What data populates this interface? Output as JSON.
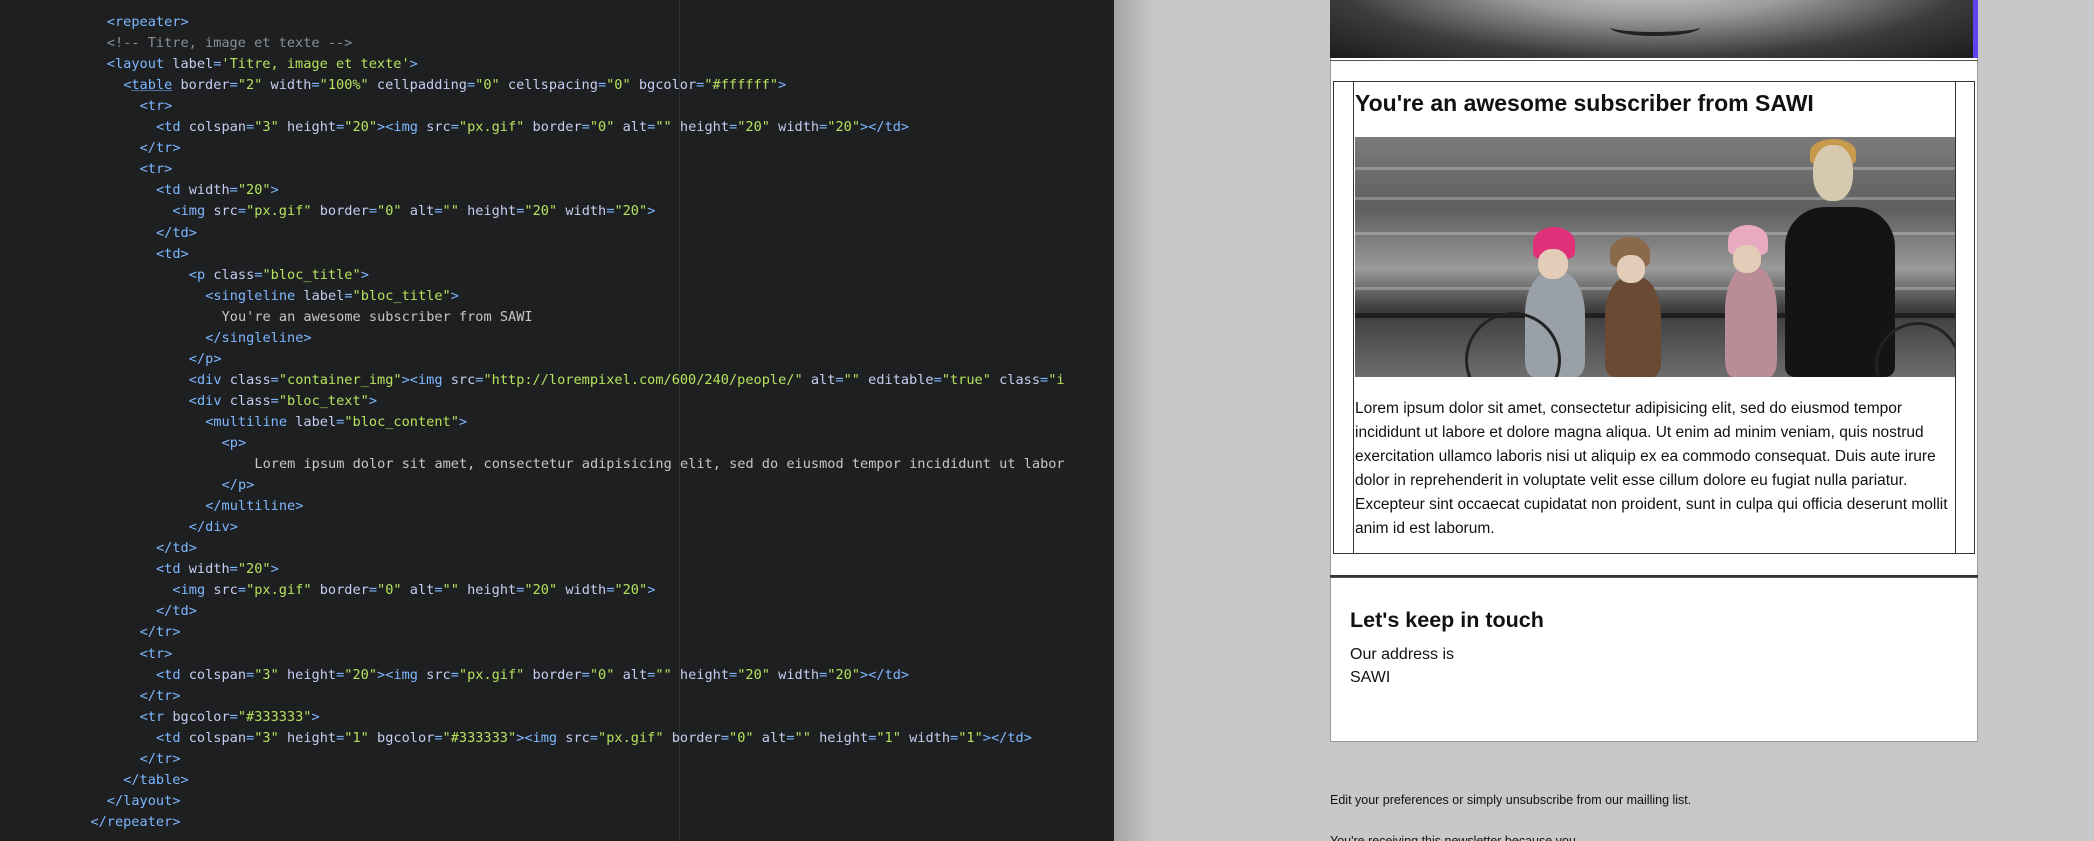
{
  "editor": {
    "lines": [
      {
        "indent": 14,
        "parts": [
          [
            "tag",
            "<repeater>"
          ]
        ]
      },
      {
        "indent": 14,
        "parts": [
          [
            "cmt",
            "<!-- Titre, image et texte -->"
          ]
        ]
      },
      {
        "indent": 14,
        "parts": [
          [
            "tag",
            "<layout "
          ],
          [
            "attr",
            "label"
          ],
          [
            "tag",
            "="
          ],
          [
            "val",
            "'Titre, image et texte'"
          ],
          [
            "tag",
            ">"
          ]
        ]
      },
      {
        "indent": 16,
        "parts": [
          [
            "tag",
            "<"
          ],
          [
            "tagu",
            "table"
          ],
          [
            "attr",
            " border"
          ],
          [
            "tag",
            "="
          ],
          [
            "val",
            "\"2\""
          ],
          [
            "attr",
            " width"
          ],
          [
            "tag",
            "="
          ],
          [
            "val",
            "\"100%\""
          ],
          [
            "attr",
            " cellpadding"
          ],
          [
            "tag",
            "="
          ],
          [
            "val",
            "\"0\""
          ],
          [
            "attr",
            " cellspacing"
          ],
          [
            "tag",
            "="
          ],
          [
            "val",
            "\"0\""
          ],
          [
            "attr",
            " bgcolor"
          ],
          [
            "tag",
            "="
          ],
          [
            "val",
            "\"#ffffff\""
          ],
          [
            "tag",
            ">"
          ]
        ]
      },
      {
        "indent": 18,
        "parts": [
          [
            "tag",
            "<tr>"
          ]
        ]
      },
      {
        "indent": 20,
        "parts": [
          [
            "tag",
            "<td "
          ],
          [
            "attr",
            "colspan"
          ],
          [
            "tag",
            "="
          ],
          [
            "val",
            "\"3\""
          ],
          [
            "attr",
            " height"
          ],
          [
            "tag",
            "="
          ],
          [
            "val",
            "\"20\""
          ],
          [
            "tag",
            "><img "
          ],
          [
            "attr",
            "src"
          ],
          [
            "tag",
            "="
          ],
          [
            "val",
            "\"px.gif\""
          ],
          [
            "attr",
            " border"
          ],
          [
            "tag",
            "="
          ],
          [
            "val",
            "\"0\""
          ],
          [
            "attr",
            " alt"
          ],
          [
            "tag",
            "="
          ],
          [
            "val",
            "\"\""
          ],
          [
            "attr",
            " height"
          ],
          [
            "tag",
            "="
          ],
          [
            "val",
            "\"20\""
          ],
          [
            "attr",
            " width"
          ],
          [
            "tag",
            "="
          ],
          [
            "val",
            "\"20\""
          ],
          [
            "tag",
            "></td>"
          ]
        ]
      },
      {
        "indent": 18,
        "parts": [
          [
            "tag",
            "</tr>"
          ]
        ]
      },
      {
        "indent": 18,
        "parts": [
          [
            "tag",
            "<tr>"
          ]
        ]
      },
      {
        "indent": 20,
        "parts": [
          [
            "tag",
            "<td "
          ],
          [
            "attr",
            "width"
          ],
          [
            "tag",
            "="
          ],
          [
            "val",
            "\"20\""
          ],
          [
            "tag",
            ">"
          ]
        ]
      },
      {
        "indent": 22,
        "parts": [
          [
            "tag",
            "<img "
          ],
          [
            "attr",
            "src"
          ],
          [
            "tag",
            "="
          ],
          [
            "val",
            "\"px.gif\""
          ],
          [
            "attr",
            " border"
          ],
          [
            "tag",
            "="
          ],
          [
            "val",
            "\"0\""
          ],
          [
            "attr",
            " alt"
          ],
          [
            "tag",
            "="
          ],
          [
            "val",
            "\"\""
          ],
          [
            "attr",
            " height"
          ],
          [
            "tag",
            "="
          ],
          [
            "val",
            "\"20\""
          ],
          [
            "attr",
            " width"
          ],
          [
            "tag",
            "="
          ],
          [
            "val",
            "\"20\""
          ],
          [
            "tag",
            ">"
          ]
        ]
      },
      {
        "indent": 20,
        "parts": [
          [
            "tag",
            "</td>"
          ]
        ]
      },
      {
        "indent": 20,
        "parts": [
          [
            "tag",
            "<td>"
          ]
        ]
      },
      {
        "indent": 24,
        "parts": [
          [
            "tag",
            "<p "
          ],
          [
            "attr",
            "class"
          ],
          [
            "tag",
            "="
          ],
          [
            "val",
            "\"bloc_title\""
          ],
          [
            "tag",
            ">"
          ]
        ]
      },
      {
        "indent": 26,
        "parts": [
          [
            "tag",
            "<singleline "
          ],
          [
            "attr",
            "label"
          ],
          [
            "tag",
            "="
          ],
          [
            "val",
            "\"bloc_title\""
          ],
          [
            "tag",
            ">"
          ]
        ]
      },
      {
        "indent": 28,
        "parts": [
          [
            "txt",
            "You're an awesome subscriber from SAWI"
          ]
        ]
      },
      {
        "indent": 26,
        "parts": [
          [
            "tag",
            "</singleline>"
          ]
        ]
      },
      {
        "indent": 24,
        "parts": [
          [
            "tag",
            "</p>"
          ]
        ]
      },
      {
        "indent": 24,
        "parts": [
          [
            "tag",
            "<div "
          ],
          [
            "attr",
            "class"
          ],
          [
            "tag",
            "="
          ],
          [
            "val",
            "\"container_img\""
          ],
          [
            "tag",
            "><img "
          ],
          [
            "attr",
            "src"
          ],
          [
            "tag",
            "="
          ],
          [
            "val",
            "\"http://lorempixel.com/600/240/people/\""
          ],
          [
            "attr",
            " alt"
          ],
          [
            "tag",
            "="
          ],
          [
            "val",
            "\"\""
          ],
          [
            "attr",
            " editable"
          ],
          [
            "tag",
            "="
          ],
          [
            "val",
            "\"true\""
          ],
          [
            "attr",
            " class"
          ],
          [
            "tag",
            "="
          ],
          [
            "val",
            "\"i"
          ]
        ]
      },
      {
        "indent": 24,
        "parts": [
          [
            "tag",
            "<div "
          ],
          [
            "attr",
            "class"
          ],
          [
            "tag",
            "="
          ],
          [
            "val",
            "\"bloc_text\""
          ],
          [
            "tag",
            ">"
          ]
        ]
      },
      {
        "indent": 26,
        "parts": [
          [
            "tag",
            "<multiline "
          ],
          [
            "attr",
            "label"
          ],
          [
            "tag",
            "="
          ],
          [
            "val",
            "\"bloc_content\""
          ],
          [
            "tag",
            ">"
          ]
        ]
      },
      {
        "indent": 28,
        "parts": [
          [
            "tag",
            "<p>"
          ]
        ]
      },
      {
        "indent": 32,
        "parts": [
          [
            "txt",
            "Lorem ipsum dolor sit amet, consectetur adipisicing elit, sed do eiusmod tempor incididunt ut labor"
          ]
        ]
      },
      {
        "indent": 28,
        "parts": [
          [
            "tag",
            "</p>"
          ]
        ]
      },
      {
        "indent": 26,
        "parts": [
          [
            "tag",
            "</multiline>"
          ]
        ]
      },
      {
        "indent": 24,
        "parts": [
          [
            "tag",
            "</div>"
          ]
        ]
      },
      {
        "indent": 20,
        "parts": [
          [
            "tag",
            "</td>"
          ]
        ]
      },
      {
        "indent": 20,
        "parts": [
          [
            "tag",
            "<td "
          ],
          [
            "attr",
            "width"
          ],
          [
            "tag",
            "="
          ],
          [
            "val",
            "\"20\""
          ],
          [
            "tag",
            ">"
          ]
        ]
      },
      {
        "indent": 22,
        "parts": [
          [
            "tag",
            "<img "
          ],
          [
            "attr",
            "src"
          ],
          [
            "tag",
            "="
          ],
          [
            "val",
            "\"px.gif\""
          ],
          [
            "attr",
            " border"
          ],
          [
            "tag",
            "="
          ],
          [
            "val",
            "\"0\""
          ],
          [
            "attr",
            " alt"
          ],
          [
            "tag",
            "="
          ],
          [
            "val",
            "\"\""
          ],
          [
            "attr",
            " height"
          ],
          [
            "tag",
            "="
          ],
          [
            "val",
            "\"20\""
          ],
          [
            "attr",
            " width"
          ],
          [
            "tag",
            "="
          ],
          [
            "val",
            "\"20\""
          ],
          [
            "tag",
            ">"
          ]
        ]
      },
      {
        "indent": 20,
        "parts": [
          [
            "tag",
            "</td>"
          ]
        ]
      },
      {
        "indent": 18,
        "parts": [
          [
            "tag",
            "</tr>"
          ]
        ]
      },
      {
        "indent": 18,
        "parts": [
          [
            "tag",
            "<tr>"
          ]
        ]
      },
      {
        "indent": 20,
        "parts": [
          [
            "tag",
            "<td "
          ],
          [
            "attr",
            "colspan"
          ],
          [
            "tag",
            "="
          ],
          [
            "val",
            "\"3\""
          ],
          [
            "attr",
            " height"
          ],
          [
            "tag",
            "="
          ],
          [
            "val",
            "\"20\""
          ],
          [
            "tag",
            "><img "
          ],
          [
            "attr",
            "src"
          ],
          [
            "tag",
            "="
          ],
          [
            "val",
            "\"px.gif\""
          ],
          [
            "attr",
            " border"
          ],
          [
            "tag",
            "="
          ],
          [
            "val",
            "\"0\""
          ],
          [
            "attr",
            " alt"
          ],
          [
            "tag",
            "="
          ],
          [
            "val",
            "\"\""
          ],
          [
            "attr",
            " height"
          ],
          [
            "tag",
            "="
          ],
          [
            "val",
            "\"20\""
          ],
          [
            "attr",
            " width"
          ],
          [
            "tag",
            "="
          ],
          [
            "val",
            "\"20\""
          ],
          [
            "tag",
            "></td>"
          ]
        ]
      },
      {
        "indent": 18,
        "parts": [
          [
            "tag",
            "</tr>"
          ]
        ]
      },
      {
        "indent": 18,
        "parts": [
          [
            "tag",
            "<tr "
          ],
          [
            "attr",
            "bgcolor"
          ],
          [
            "tag",
            "="
          ],
          [
            "val",
            "\"#333333\""
          ],
          [
            "tag",
            ">"
          ]
        ]
      },
      {
        "indent": 20,
        "parts": [
          [
            "tag",
            "<td "
          ],
          [
            "attr",
            "colspan"
          ],
          [
            "tag",
            "="
          ],
          [
            "val",
            "\"3\""
          ],
          [
            "attr",
            " height"
          ],
          [
            "tag",
            "="
          ],
          [
            "val",
            "\"1\""
          ],
          [
            "attr",
            " bgcolor"
          ],
          [
            "tag",
            "="
          ],
          [
            "val",
            "\"#333333\""
          ],
          [
            "tag",
            "><img "
          ],
          [
            "attr",
            "src"
          ],
          [
            "tag",
            "="
          ],
          [
            "val",
            "\"px.gif\""
          ],
          [
            "attr",
            " border"
          ],
          [
            "tag",
            "="
          ],
          [
            "val",
            "\"0\""
          ],
          [
            "attr",
            " alt"
          ],
          [
            "tag",
            "="
          ],
          [
            "val",
            "\"\""
          ],
          [
            "attr",
            " height"
          ],
          [
            "tag",
            "="
          ],
          [
            "val",
            "\"1\""
          ],
          [
            "attr",
            " width"
          ],
          [
            "tag",
            "="
          ],
          [
            "val",
            "\"1\""
          ],
          [
            "tag",
            "></td>"
          ]
        ]
      },
      {
        "indent": 18,
        "parts": [
          [
            "tag",
            "</tr>"
          ]
        ]
      },
      {
        "indent": 16,
        "parts": [
          [
            "tag",
            "</table>"
          ]
        ]
      },
      {
        "indent": 14,
        "parts": [
          [
            "tag",
            "</layout>"
          ]
        ]
      },
      {
        "indent": 12,
        "parts": [
          [
            "tag",
            "</repeater>"
          ]
        ]
      }
    ]
  },
  "email": {
    "block_title": "You're an awesome subscriber from SAWI",
    "block_text": "Lorem ipsum dolor sit amet, consectetur adipisicing elit, sed do eiusmod tempor incididunt ut labore et dolore magna aliqua. Ut enim ad minim veniam, quis nostrud exercitation ullamco laboris nisi ut aliquip ex ea commodo consequat. Duis aute irure dolor in reprehenderit in voluptate velit esse cillum dolore eu fugiat nulla pariatur. Excepteur sint occaecat cupidatat non proident, sunt in culpa qui officia deserunt mollit anim id est laborum.",
    "footer_title": "Let's keep in touch",
    "address_label": "Our address is",
    "address_name": "SAWI",
    "preferences_text": "Edit your preferences or simply unsubscribe from our mailling list.",
    "cut_text": "You're receiving this newsletter because you"
  },
  "colors": {
    "editor_bg": "#1d1f21",
    "tag": "#7fb7ff",
    "attribute": "#c8ccf0",
    "value": "#b5e35c",
    "comment": "#8a8f94",
    "preview_bg": "#c8c8c8",
    "scroll_accent": "#5b45f0"
  }
}
